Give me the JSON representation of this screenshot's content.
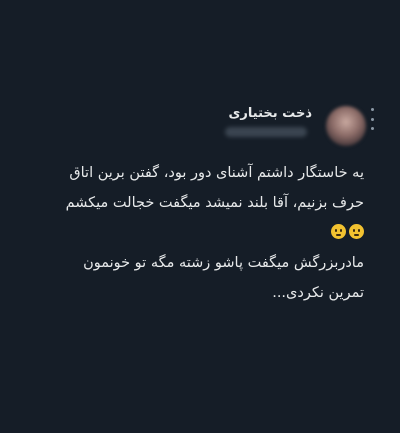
{
  "tweet": {
    "author_name": "ذخت بختیاری",
    "text_lines": [
      "یه خاستگار داشتم آشنای دور بود، گفتن برین اتاق",
      "حرف بزنیم، آقا بلند نمیشد میگفت خجالت میکشم",
      "مادربزرگش میگفت پاشو زشته مگه تو خونمون",
      "تمرین نکردی..."
    ],
    "emojis": [
      "confused-face-icon",
      "confused-face-icon"
    ]
  },
  "colors": {
    "background": "#151d27",
    "text": "#e7e9ea",
    "muted": "#8b98a5"
  }
}
